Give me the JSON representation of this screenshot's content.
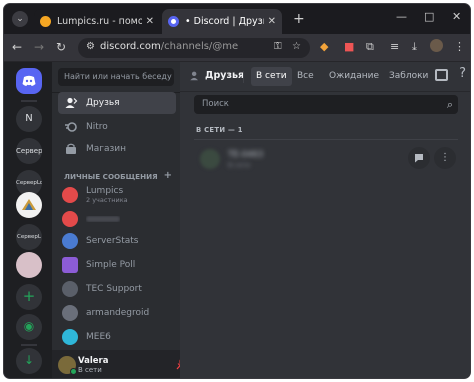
{
  "browser": {
    "tabs": [
      {
        "title": "Lumpics.ru - помощь с компь…",
        "favicon_color": "#f5a623"
      },
      {
        "title": "• Discord | Друзья",
        "favicon_color": "#ffffff"
      }
    ],
    "new_tab": "+",
    "window": {
      "minimize": "—",
      "maximize": "□",
      "close": "✕"
    },
    "url_host": "discord.com",
    "url_path": "/channels/@me"
  },
  "guilds": [
    {
      "label": "N"
    },
    {
      "label": "Сервер"
    },
    {
      "label": "СерверLo"
    },
    {
      "label": "СерверL"
    },
    {
      "label": "+"
    },
    {
      "label": "◉"
    },
    {
      "label": "↓"
    }
  ],
  "sidebar": {
    "search_placeholder": "Найти или начать беседу",
    "nav": [
      {
        "label": "Друзья"
      },
      {
        "label": "Nitro"
      },
      {
        "label": "Магазин"
      }
    ],
    "dm_header": "ЛИЧНЫЕ СООБЩЕНИЯ",
    "dm_add": "+",
    "dms": [
      {
        "name": "Lumpics",
        "sub": "2 участника",
        "color": "#e34a4a"
      },
      {
        "name": "",
        "sub": "",
        "color": "#e34a4a"
      },
      {
        "name": "ServerStats",
        "sub": "",
        "color": "#4a7bd1"
      },
      {
        "name": "Simple Poll",
        "sub": "",
        "color": "#8c5cd6"
      },
      {
        "name": "TEC Support",
        "sub": "",
        "color": "#5a5f69"
      },
      {
        "name": "armandegroid",
        "sub": "",
        "color": "#6a6f7a"
      },
      {
        "name": "MEE6",
        "sub": "",
        "color": "#2fb7d9"
      }
    ]
  },
  "user": {
    "name": "Valera",
    "status": "В сети"
  },
  "main": {
    "title": "Друзья",
    "tabs": [
      {
        "label": "В сети"
      },
      {
        "label": "Все"
      },
      {
        "label": "Ожидание"
      },
      {
        "label": "Заблоки"
      }
    ],
    "search_placeholder": "Поиск",
    "online_count": "В СЕТИ — 1",
    "friend": {
      "name": "TE-0463",
      "sub": "В сети"
    }
  },
  "colors": {
    "blurple": "#5865f2",
    "online_green": "#23a55a",
    "highlight_red": "#ff1a1a"
  }
}
